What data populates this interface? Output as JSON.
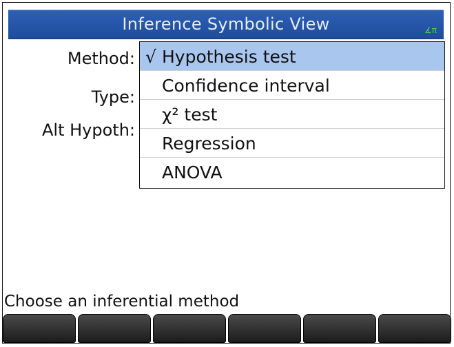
{
  "header": {
    "title": "Inference Symbolic View",
    "angle_indicator": "∡π"
  },
  "form": {
    "method_label": "Method:",
    "type_label": "Type:",
    "alt_hypoth_label": "Alt Hypoth:"
  },
  "method_dropdown": {
    "selected_index": 0,
    "check_mark": "√",
    "options": [
      "Hypothesis test",
      "Confidence interval",
      "χ² test",
      "Regression",
      "ANOVA"
    ]
  },
  "status": {
    "hint": "Choose an inferential method"
  },
  "softkeys": {
    "count": 6,
    "labels": [
      "",
      "",
      "",
      "",
      "",
      ""
    ]
  },
  "colors": {
    "titlebar": "#2457a8",
    "selection": "#a9c6ee",
    "angle_indicator": "#4fd44a"
  }
}
